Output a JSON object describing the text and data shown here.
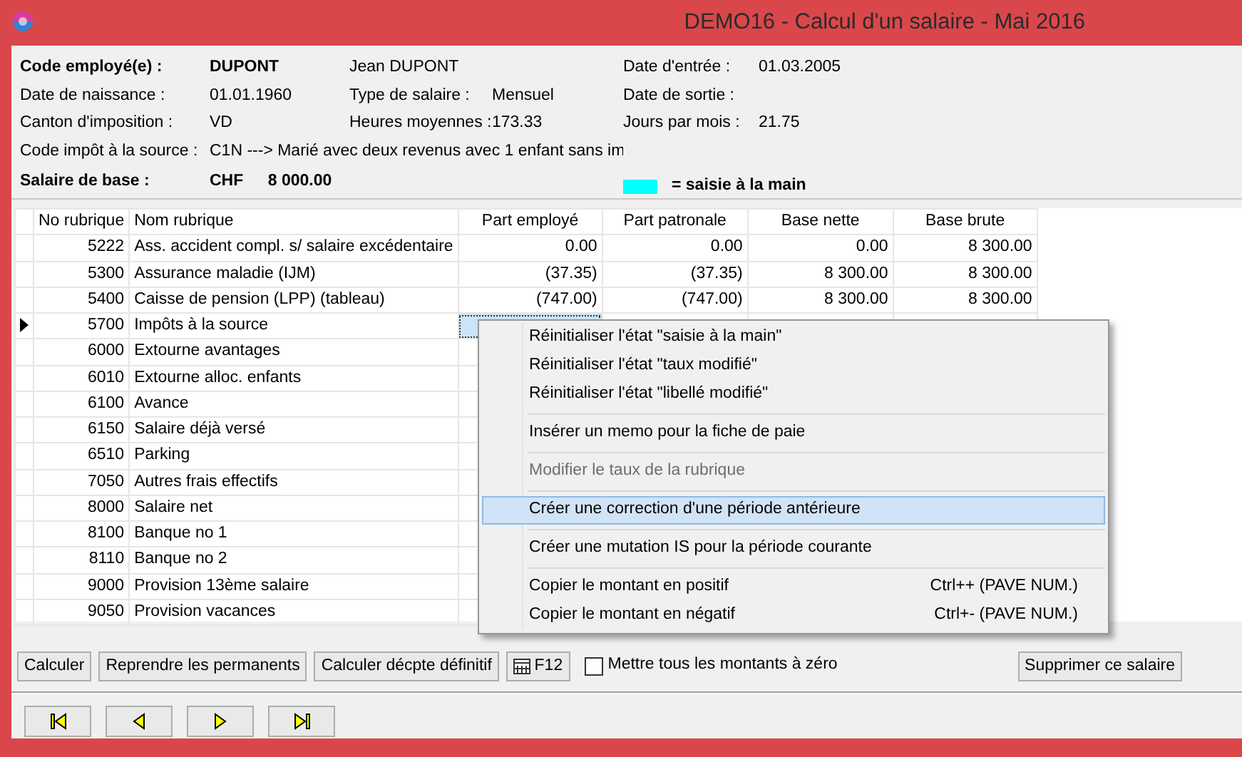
{
  "window": {
    "title": "DEMO16 - Calcul d'un salaire - Mai 2016"
  },
  "info": {
    "rows": [
      {
        "bold": true,
        "fields": [
          {
            "label": "Code employé(e) :",
            "value": "DUPONT"
          },
          {
            "value": "Jean DUPONT"
          },
          {
            "label": "Date d'entrée :",
            "value": "01.03.2005"
          }
        ]
      },
      {
        "bold": false,
        "fields": [
          {
            "label": "Date de naissance :",
            "value": "01.01.1960"
          },
          {
            "label": "Type de salaire :",
            "value": "Mensuel"
          },
          {
            "label": "Date de sortie :"
          }
        ]
      },
      {
        "bold": false,
        "fields": [
          {
            "label": "Canton d'imposition :",
            "value": "VD"
          },
          {
            "label": "Heures moyennes :",
            "value": "173.33"
          },
          {
            "label": "Jours par mois :",
            "value": "21.75"
          }
        ]
      },
      {
        "bold": false,
        "fields": [
          {
            "label": "Code impôt à la source :",
            "value": "C1N ---> Marié avec deux revenus avec 1 enfant sans im"
          }
        ]
      },
      {
        "bold": true,
        "fields": [
          {
            "label": "Salaire de  base :",
            "value": "CHF",
            "amount": "8 000.00"
          }
        ],
        "legend": {
          "color": "#00ffff",
          "text": "= saisie à la main"
        }
      }
    ]
  },
  "table": {
    "columns": [
      "No rubrique",
      "Nom rubrique",
      "Part employé",
      "Part patronale",
      "Base nette",
      "Base brute"
    ],
    "rows": [
      {
        "number": "5222",
        "name": "Ass. accident compl. s/ salaire excédentaire",
        "values": [
          "0.00",
          "0.00",
          "0.00",
          "8 300.00"
        ],
        "current": false,
        "focused": false
      },
      {
        "number": "5300",
        "name": "Assurance maladie (IJM)",
        "values": [
          "(37.35)",
          "(37.35)",
          "8 300.00",
          "8 300.00"
        ],
        "current": false,
        "focused": false
      },
      {
        "number": "5400",
        "name": "Caisse de pension (LPP) (tableau)",
        "values": [
          "(747.00)",
          "(747.00)",
          "8 300.00",
          "8 300.00"
        ],
        "current": false,
        "focused": false
      },
      {
        "number": "5700",
        "name": "Impôts à la source",
        "current": true,
        "focused": true
      },
      {
        "number": "6000",
        "name": "Extourne avantages",
        "current": false,
        "focused": false
      },
      {
        "number": "6010",
        "name": "Extourne alloc. enfants",
        "current": false,
        "focused": false
      },
      {
        "number": "6100",
        "name": "Avance",
        "current": false,
        "focused": false
      },
      {
        "number": "6150",
        "name": "Salaire déjà versé",
        "current": false,
        "focused": false
      },
      {
        "number": "6510",
        "name": "Parking",
        "current": false,
        "focused": false
      },
      {
        "number": "7050",
        "name": "Autres frais effectifs",
        "current": false,
        "focused": false
      },
      {
        "number": "8000",
        "name": "Salaire net",
        "current": false,
        "focused": false
      },
      {
        "number": "8100",
        "name": "Banque no 1",
        "current": false,
        "focused": false
      },
      {
        "number": "8110",
        "name": "Banque no 2",
        "current": false,
        "focused": false
      },
      {
        "number": "9000",
        "name": "Provision 13ème salaire",
        "current": false,
        "focused": false
      },
      {
        "number": "9050",
        "name": "Provision vacances",
        "current": false,
        "focused": false
      }
    ]
  },
  "actions": [
    {
      "kind": "button",
      "label": "Calculer"
    },
    {
      "kind": "button",
      "label": "Reprendre les permanents"
    },
    {
      "kind": "button",
      "label": "Calculer décpte définitif"
    },
    {
      "kind": "key",
      "label": "F12"
    },
    {
      "kind": "checkbox",
      "label": "Mettre tous les montants à zéro",
      "checked": false
    },
    {
      "kind": "button",
      "label": "Supprimer ce salaire"
    }
  ],
  "navigation": [
    {
      "kind": "first"
    },
    {
      "kind": "previous"
    },
    {
      "kind": "next"
    },
    {
      "kind": "last"
    }
  ],
  "context_menu": {
    "items": [
      {
        "kind": "item",
        "label": "Réinitialiser l'état \"saisie à la main\"",
        "disabled": false,
        "selected": false
      },
      {
        "kind": "item",
        "label": "Réinitialiser l'état \"taux modifié\"",
        "disabled": false,
        "selected": false
      },
      {
        "kind": "item",
        "label": "Réinitialiser l'état \"libellé modifié\"",
        "disabled": false,
        "selected": false
      },
      {
        "kind": "separator"
      },
      {
        "kind": "item",
        "label": "Insérer un memo pour la fiche de paie",
        "disabled": false,
        "selected": false
      },
      {
        "kind": "separator"
      },
      {
        "kind": "item",
        "label": "Modifier le taux de la rubrique",
        "disabled": true,
        "selected": false
      },
      {
        "kind": "separator"
      },
      {
        "kind": "item",
        "label": "Créer une correction d'une période antérieure",
        "disabled": false,
        "selected": true
      },
      {
        "kind": "separator"
      },
      {
        "kind": "item",
        "label": "Créer une mutation IS pour la période courante",
        "disabled": false,
        "selected": false
      },
      {
        "kind": "separator"
      },
      {
        "kind": "item",
        "label": "Copier le montant en positif",
        "shortcut": "Ctrl++ (PAVE NUM.)",
        "disabled": false,
        "selected": false
      },
      {
        "kind": "item",
        "label": "Copier le montant en négatif",
        "shortcut": "Ctrl+- (PAVE NUM.)",
        "disabled": false,
        "selected": false
      }
    ]
  }
}
